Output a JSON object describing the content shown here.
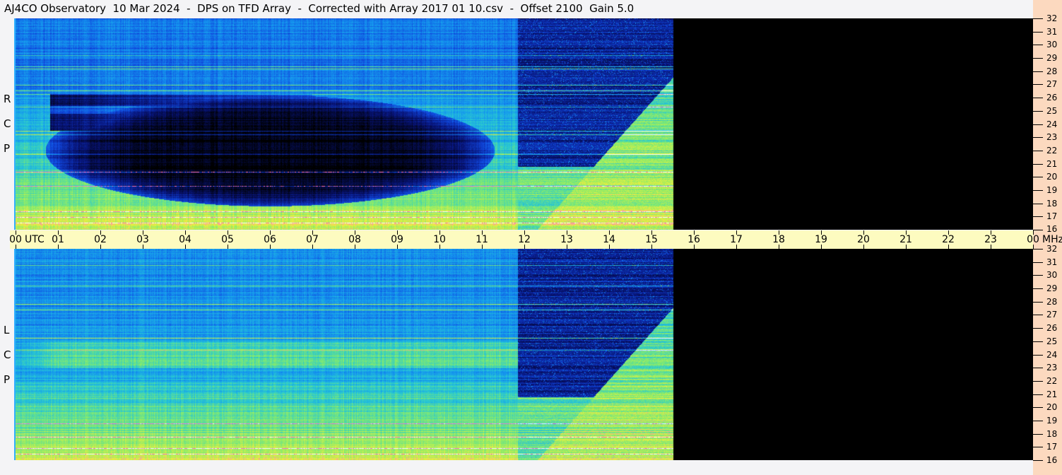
{
  "title": "AJ4CO Observatory  10 Mar 2024  -  DPS on TFD Array  -  Corrected with Array 2017 01 10.csv  -  Offset 2100  Gain 5.0",
  "chart_data": {
    "type": "heatmap",
    "title": "AJ4CO Observatory  10 Mar 2024  -  DPS on TFD Array  -  Corrected with Array 2017 01 10.csv  -  Offset 2100  Gain 5.0",
    "xlabel": "UTC",
    "ylabel": "MHz",
    "x_ticks": [
      "00",
      "01",
      "02",
      "03",
      "04",
      "05",
      "06",
      "07",
      "08",
      "09",
      "10",
      "11",
      "12",
      "13",
      "14",
      "15",
      "16",
      "17",
      "18",
      "19",
      "20",
      "21",
      "22",
      "23",
      "00"
    ],
    "xlim": [
      0,
      24
    ],
    "ylim": [
      16,
      32
    ],
    "y_ticks": [
      16,
      17,
      18,
      19,
      20,
      21,
      22,
      23,
      24,
      25,
      26,
      27,
      28,
      29,
      30,
      31,
      32
    ],
    "data_end_utc": 15.5,
    "panels": [
      {
        "name": "RCP",
        "letters": [
          "R",
          "C",
          "P"
        ]
      },
      {
        "name": "LCP",
        "letters": [
          "L",
          "C",
          "P"
        ]
      }
    ]
  },
  "colors": {
    "axis_band": "#fdfbc0",
    "right_axis": "#fcd9bf",
    "background": "#f4f4f6"
  }
}
